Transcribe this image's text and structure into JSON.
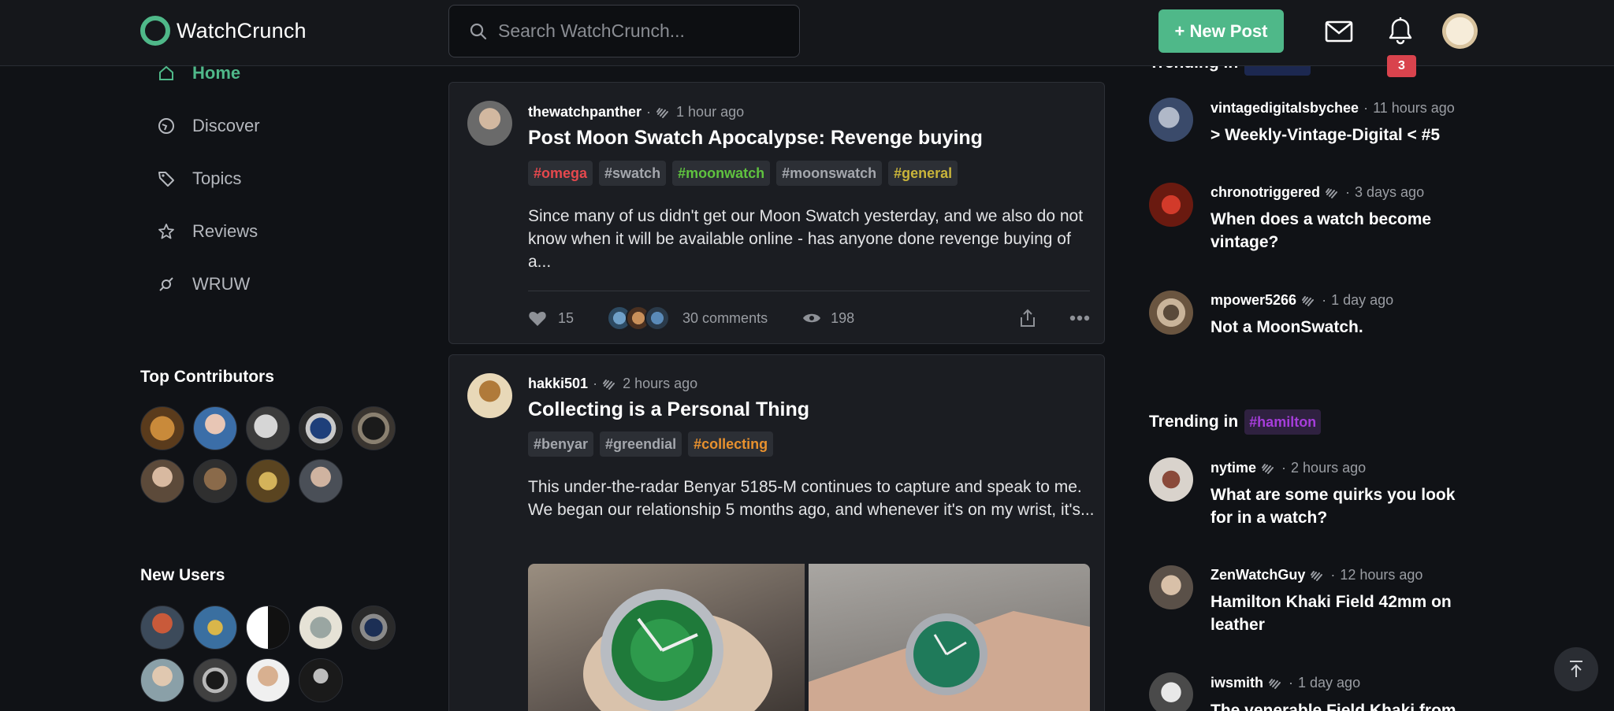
{
  "app": {
    "name": "WatchCrunch"
  },
  "header": {
    "search_placeholder": "Search WatchCrunch...",
    "new_post_label": "+ New Post",
    "notification_count": "3"
  },
  "sidebar": {
    "items": [
      {
        "label": "Home",
        "icon": "home-icon",
        "active": true
      },
      {
        "label": "Discover",
        "icon": "discover-icon"
      },
      {
        "label": "Topics",
        "icon": "tag-icon"
      },
      {
        "label": "Reviews",
        "icon": "star-icon"
      },
      {
        "label": "WRUW",
        "icon": "wruw-icon"
      }
    ],
    "top_contributors_title": "Top Contributors",
    "new_users_title": "New Users"
  },
  "feed": {
    "posts": [
      {
        "author": "thewatchpanther",
        "time": "1 hour ago",
        "title": "Post Moon Swatch Apocalypse: Revenge buying",
        "tags": [
          {
            "label": "#omega",
            "color": "#e5484d"
          },
          {
            "label": "#swatch",
            "color": "#a4a7ad"
          },
          {
            "label": "#moonwatch",
            "color": "#5fc23f"
          },
          {
            "label": "#moonswatch",
            "color": "#a4a7ad"
          },
          {
            "label": "#general",
            "color": "#c9b43a"
          }
        ],
        "excerpt": "Since many of us didn't get our Moon Swatch yesterday, and we also do not know when it will be available online - has anyone done revenge buying of a...",
        "likes": "15",
        "comments": "30 comments",
        "views": "198"
      },
      {
        "author": "hakki501",
        "time": "2 hours ago",
        "title": "Collecting is a Personal Thing",
        "tags": [
          {
            "label": "#benyar",
            "color": "#a4a7ad"
          },
          {
            "label": "#greendial",
            "color": "#a4a7ad"
          },
          {
            "label": "#collecting",
            "color": "#e8912e"
          }
        ],
        "excerpt": "This under-the-radar Benyar 5185-M continues to capture and speak to me. We began our relationship 5 months ago, and whenever it's on my wrist, it's..."
      }
    ]
  },
  "trending": [
    {
      "title": "Trending in",
      "tag": "",
      "posts": [
        {
          "author": "vintagedigitalsbychee",
          "time": "11 hours ago",
          "title": "> Weekly-Vintage-Digital < #5"
        },
        {
          "author": "chronotriggered",
          "time": "3 days ago",
          "title": "When does a watch become vintage?"
        },
        {
          "author": "mpower5266",
          "time": "1 day ago",
          "title": "Not a MoonSwatch."
        }
      ]
    },
    {
      "title": "Trending in",
      "tag": "#hamilton",
      "posts": [
        {
          "author": "nytime",
          "time": "2 hours ago",
          "title": "What are some quirks you look for in a watch?"
        },
        {
          "author": "ZenWatchGuy",
          "time": "12 hours ago",
          "title": "Hamilton Khaki Field 42mm on leather"
        },
        {
          "author": "iwsmith",
          "time": "1 day ago",
          "title": "The venerable Field Khaki from"
        }
      ]
    }
  ],
  "colors": {
    "accent": "#4fb889",
    "background": "#101216",
    "card": "#1b1d22",
    "badge": "#d9434d"
  }
}
